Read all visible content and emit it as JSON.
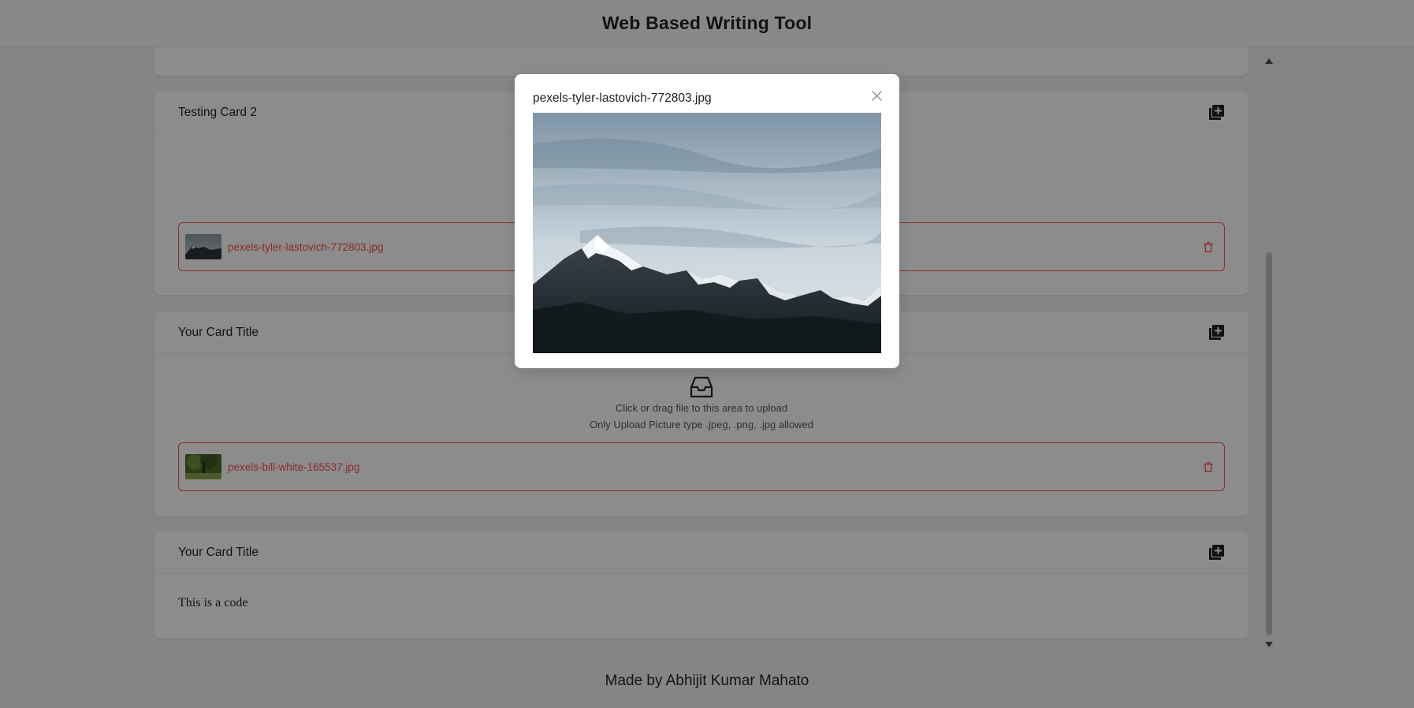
{
  "header": {
    "title": "Web Based Writing Tool"
  },
  "cards": [
    {
      "title": "Testing Card 2",
      "file": {
        "name": "pexels-tyler-lastovich-772803.jpg"
      }
    },
    {
      "title": "Your Card Title",
      "upload": {
        "hint": "Click or drag file to this area to upload",
        "allowed": "Only Upload Picture type .jpeg, .png, .jpg allowed"
      },
      "file": {
        "name": "pexels-bill-white-165537.jpg"
      }
    },
    {
      "title": "Your Card Title",
      "content": "This is a code"
    }
  ],
  "footer": {
    "text": "Made by Abhijit Kumar Mahato"
  },
  "preview_modal": {
    "title": "pexels-tyler-lastovich-772803.jpg"
  },
  "icons": {
    "add": "add-card-icon",
    "delete": "delete-icon",
    "close": "close-icon",
    "upload": "inbox-icon",
    "scroll_up": "arrow-up-icon",
    "scroll_down": "arrow-down-icon"
  },
  "colors": {
    "error": "#ff4d4f",
    "overlay": "rgba(0,0,0,0.45)"
  }
}
